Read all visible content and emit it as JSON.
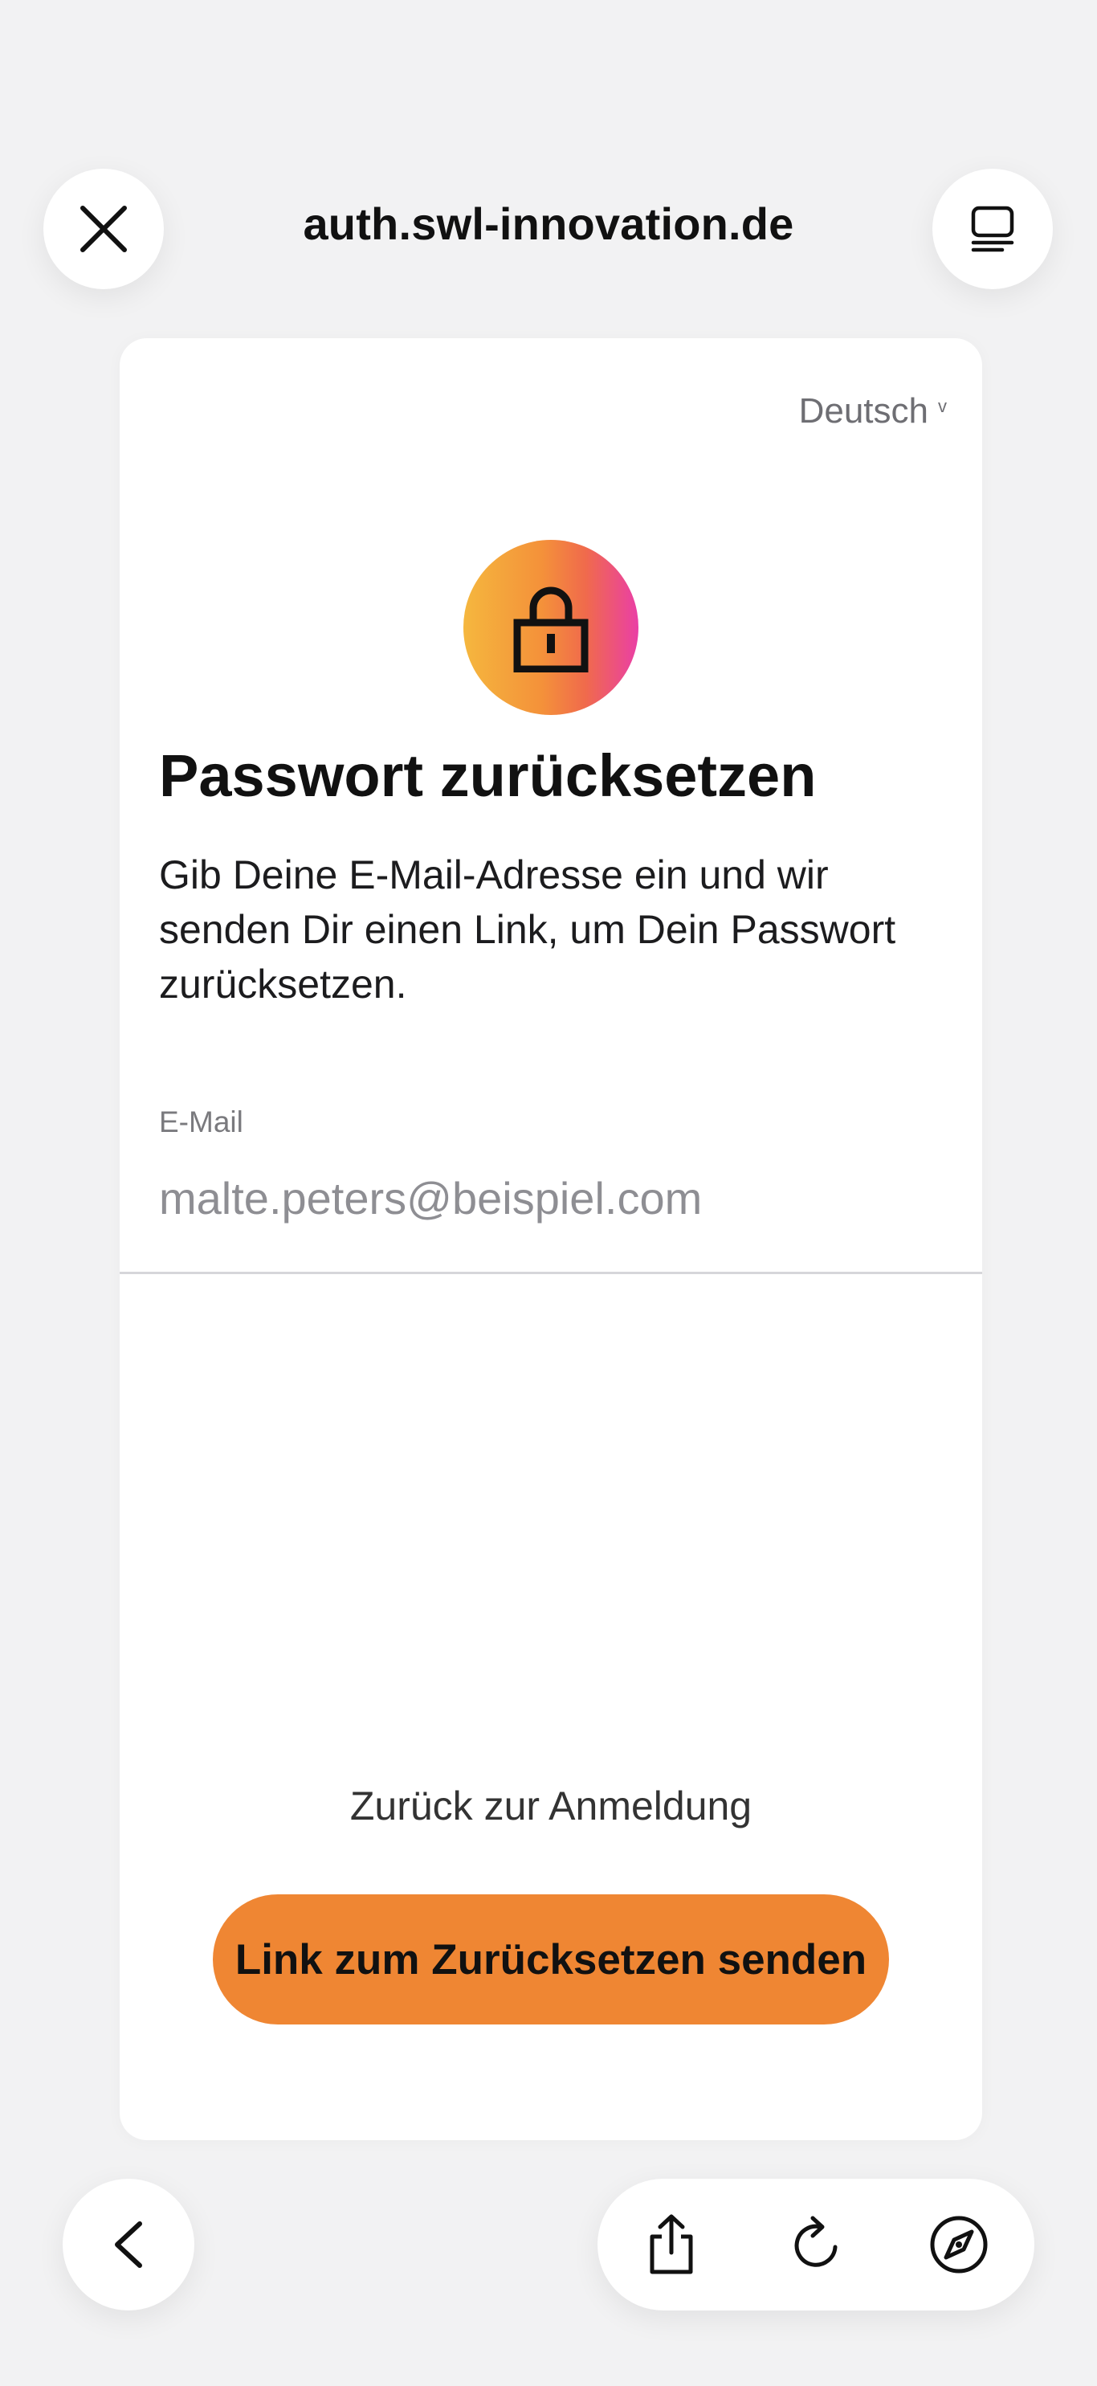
{
  "browser": {
    "url": "auth.swl-innovation.de",
    "close_icon": "close-icon",
    "menu_icon": "tab-overview-icon"
  },
  "form": {
    "language": "Deutsch",
    "lock_icon": "lock-icon",
    "title": "Passwort zurücksetzen",
    "description": "Gib Deine E-Mail-Adresse ein und wir senden Dir einen Link, um Dein Passwort zurücksetzen.",
    "email_label": "E-Mail",
    "email_placeholder": "malte.peters@beispiel.com",
    "email_value": "",
    "back_link": "Zurück zur Anmeldung",
    "submit_label": "Link zum Zurücksetzen senden"
  },
  "bottom_bar": {
    "back_icon": "chevron-left-icon",
    "share_icon": "share-icon",
    "reload_icon": "reload-icon",
    "compass_icon": "compass-icon"
  },
  "colors": {
    "page_background": "#f2f2f3",
    "primary_button": "#ef8633",
    "lock_gradient_start": "#f5b73e",
    "lock_gradient_end": "#ea3fa6"
  }
}
